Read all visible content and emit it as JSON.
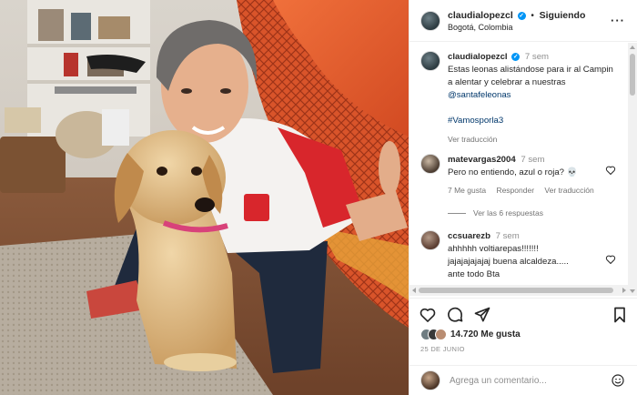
{
  "post": {
    "author": "claudialopezcl",
    "verified": true,
    "follow_status": "Siguiendo",
    "location": "Bogotá, Colombia",
    "more_icon": "more-horizontal-icon"
  },
  "caption": {
    "username": "claudialopezcl",
    "time": "7 sem",
    "text": "Estas leonas alistándose para ir al Campin a alentar y celebrar a nuestras",
    "mention": "@santafeleonas",
    "hashtag": "#Vamosporla3",
    "translate": "Ver traducción"
  },
  "comments": [
    {
      "username": "matevargas2004",
      "time": "7 sem",
      "text": "Pero no entiendo, azul o roja? 💀",
      "likes": "7 Me gusta",
      "reply": "Responder",
      "translate": "Ver traducción",
      "view_replies": "Ver las 6 respuestas"
    },
    {
      "username": "ccsuarezb",
      "time": "7 sem",
      "text_line1": "ahhhhh voltiarepas!!!!!!!",
      "text_line2": "jajajajajajaj buena alcaldeza.....",
      "text_line3": "ante todo Bta"
    }
  ],
  "actions": {
    "like_icon": "heart-icon",
    "comment_icon": "comment-icon",
    "share_icon": "send-icon",
    "save_icon": "bookmark-icon"
  },
  "likes": {
    "count_text": "14.720 Me gusta"
  },
  "date": "25 DE JUNIO",
  "add_comment": {
    "placeholder": "Agrega un comentario...",
    "emoji_icon": "emoji-icon"
  },
  "colors": {
    "link": "#00376b",
    "verified": "#0095f6",
    "muted": "#737373",
    "hammock": "#ea5a2a",
    "jersey_red": "#d8262c"
  }
}
